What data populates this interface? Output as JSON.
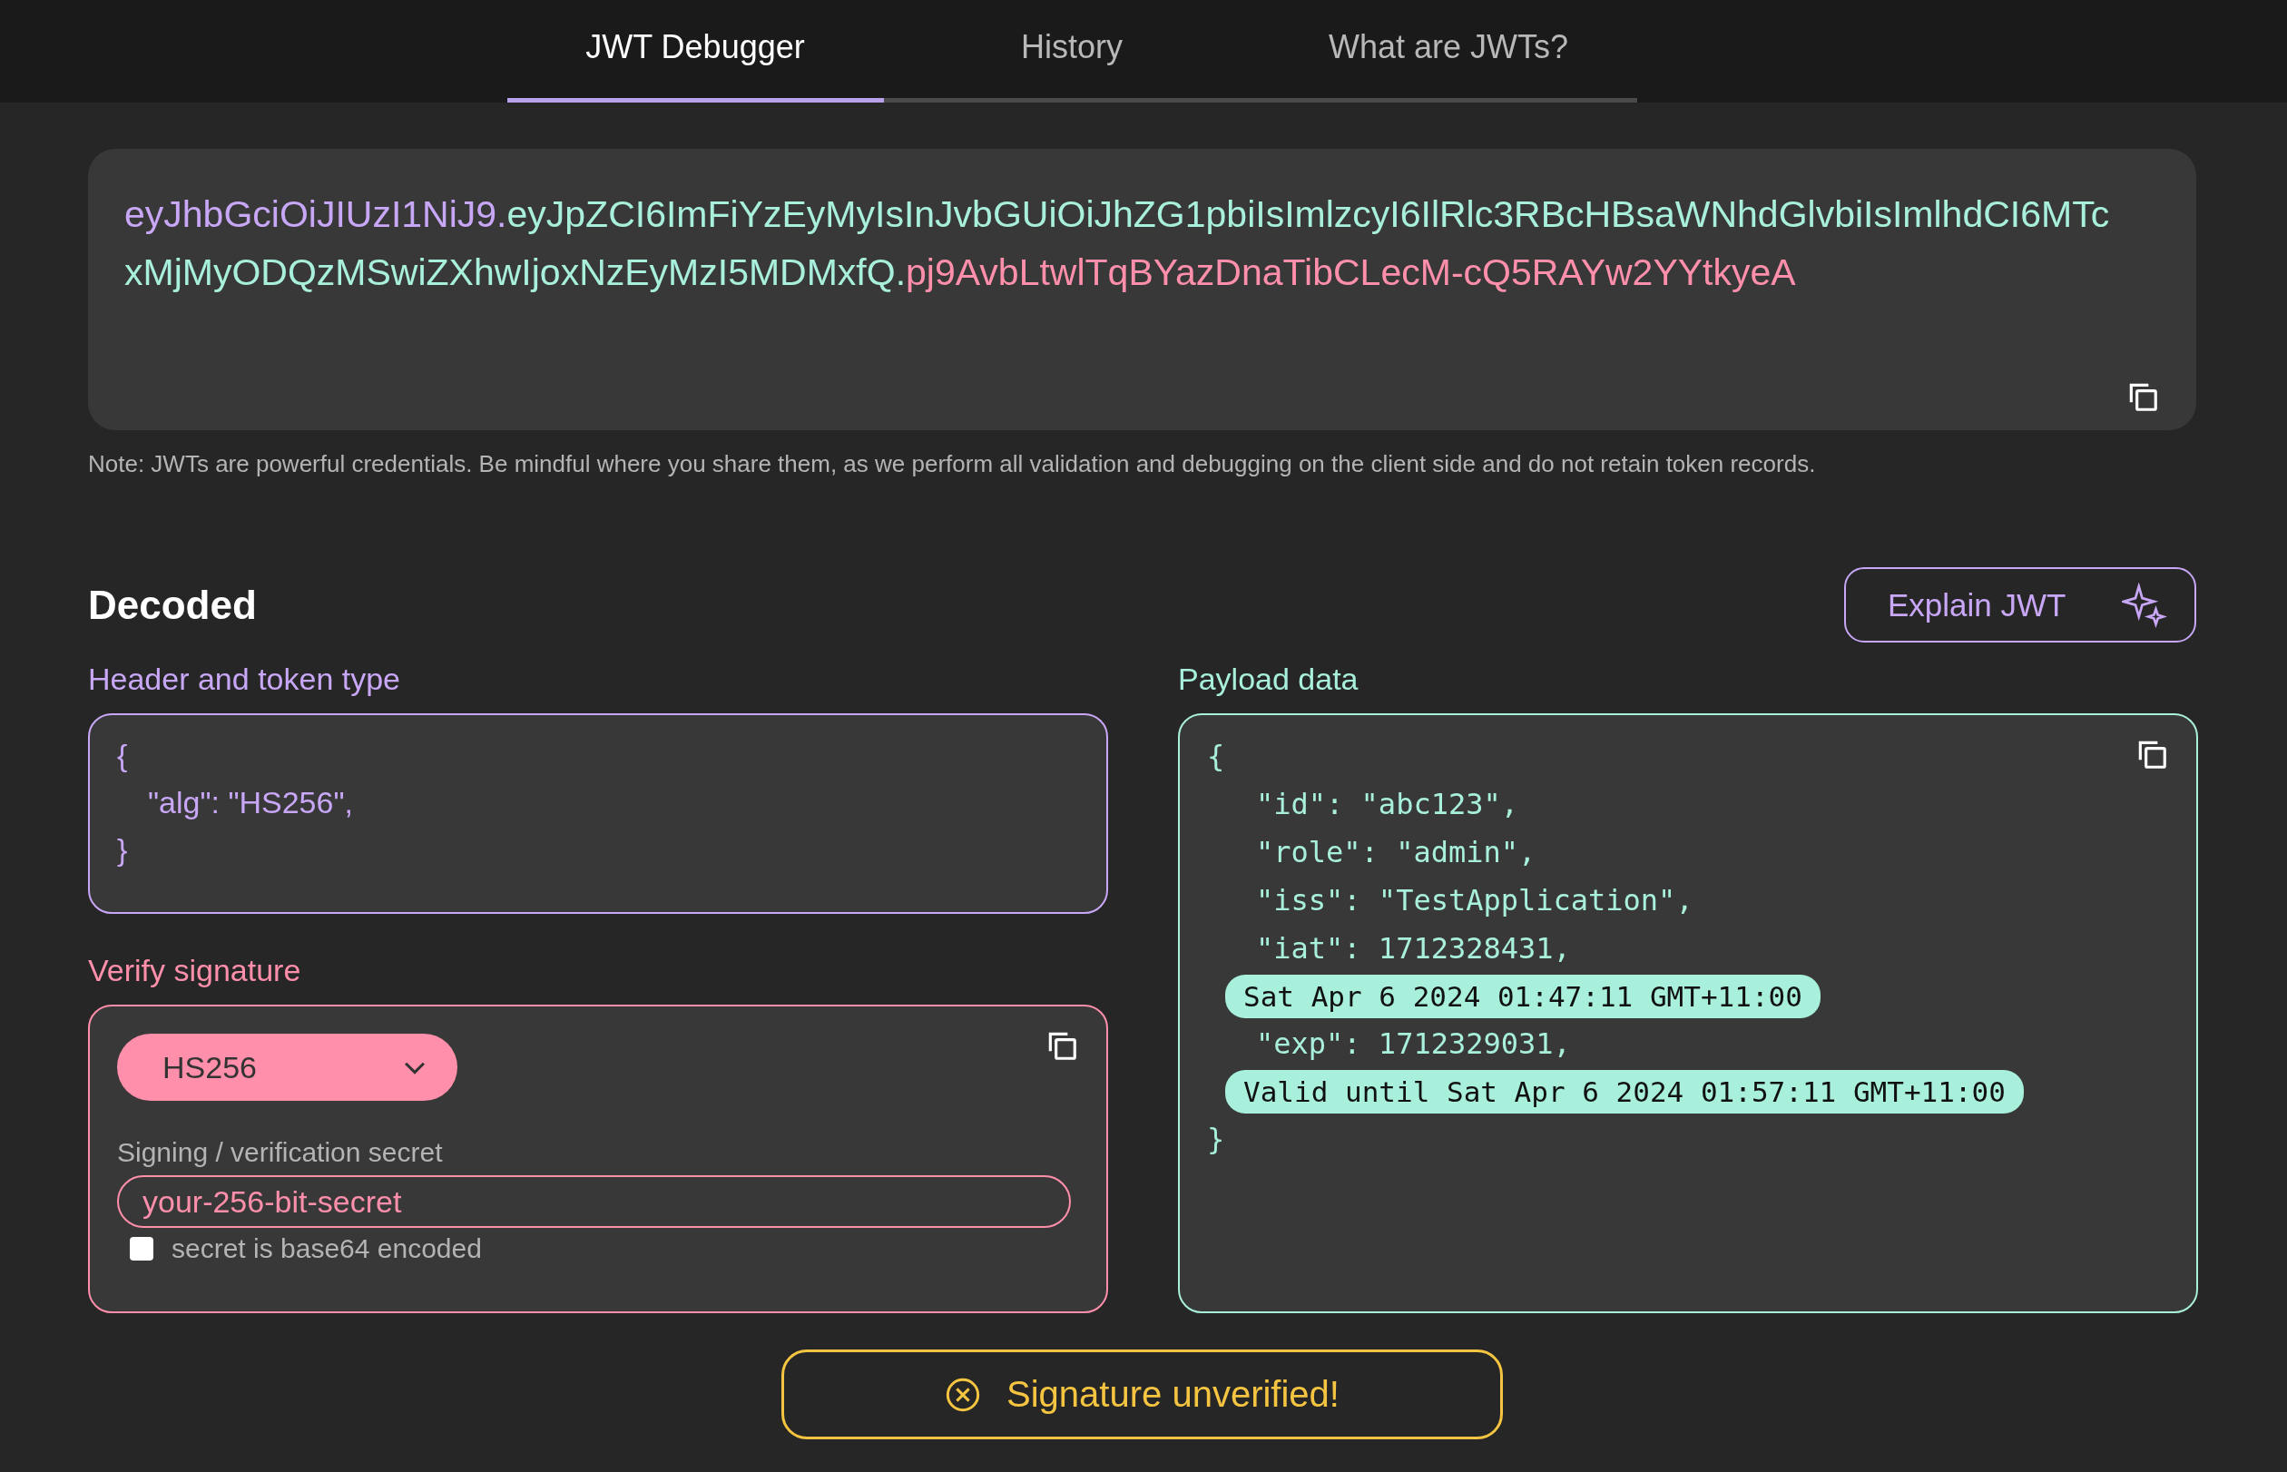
{
  "tabs": [
    {
      "label": "JWT Debugger",
      "selected": true
    },
    {
      "label": "History",
      "selected": false
    },
    {
      "label": "What are JWTs?",
      "selected": false
    }
  ],
  "encoded": {
    "token": [
      {
        "text": "eyJhbGciOiJIUzI1NiJ9.",
        "color": "#c9a7f7"
      },
      {
        "text": "eyJpZCI6ImFiYzEyMyIsInJvbGUiOiJhZG1pbiIsImlzcyI6IlRlc3RBcHBsaWNhdGlvbiIsImlhdCI6MTcxMjMyODQzMSwiZXhwIjoxNzEyMzI5MDMxfQ.",
        "color": "#a8f0dc"
      },
      {
        "text": "pj9AvbLtwlTqBYazDnaTibCLecM-cQ5RAYw2YYtkyeA",
        "color": "#ff8fab"
      }
    ],
    "note": "Note: JWTs are powerful credentials. Be mindful where you share them, as we perform all validation and debugging on the client side and do not retain token records."
  },
  "decoded": {
    "title": "Decoded",
    "explain_button": "Explain JWT",
    "header": {
      "label": "Header and token type",
      "lines": [
        {
          "kind": "brace",
          "text": "{"
        },
        {
          "kind": "field",
          "text": "\"alg\": \"HS256\","
        },
        {
          "kind": "brace",
          "text": "}"
        }
      ]
    },
    "verify": {
      "label": "Verify signature",
      "algorithm": "HS256",
      "secret_label": "Signing / verification secret",
      "secret": "your-256-bit-secret",
      "base64": {
        "label": "secret is base64 encoded",
        "checked": false
      }
    },
    "payload": {
      "label": "Payload data",
      "lines": [
        {
          "kind": "brace",
          "text": "{"
        },
        {
          "kind": "field",
          "text": "\"id\": \"abc123\","
        },
        {
          "kind": "field",
          "text": "\"role\": \"admin\","
        },
        {
          "kind": "field",
          "text": "\"iss\": \"TestApplication\","
        },
        {
          "kind": "field",
          "text": "\"iat\": 1712328431,"
        },
        {
          "kind": "note",
          "text": "Sat Apr 6 2024 01:47:11 GMT+11:00"
        },
        {
          "kind": "field",
          "text": "\"exp\": 1712329031,"
        },
        {
          "kind": "note",
          "text": "Valid until Sat Apr 6 2024 01:57:11 GMT+11:00"
        },
        {
          "kind": "brace",
          "text": "}"
        }
      ]
    }
  },
  "status": {
    "kind": "unverified",
    "text": "Signature unverified!"
  }
}
